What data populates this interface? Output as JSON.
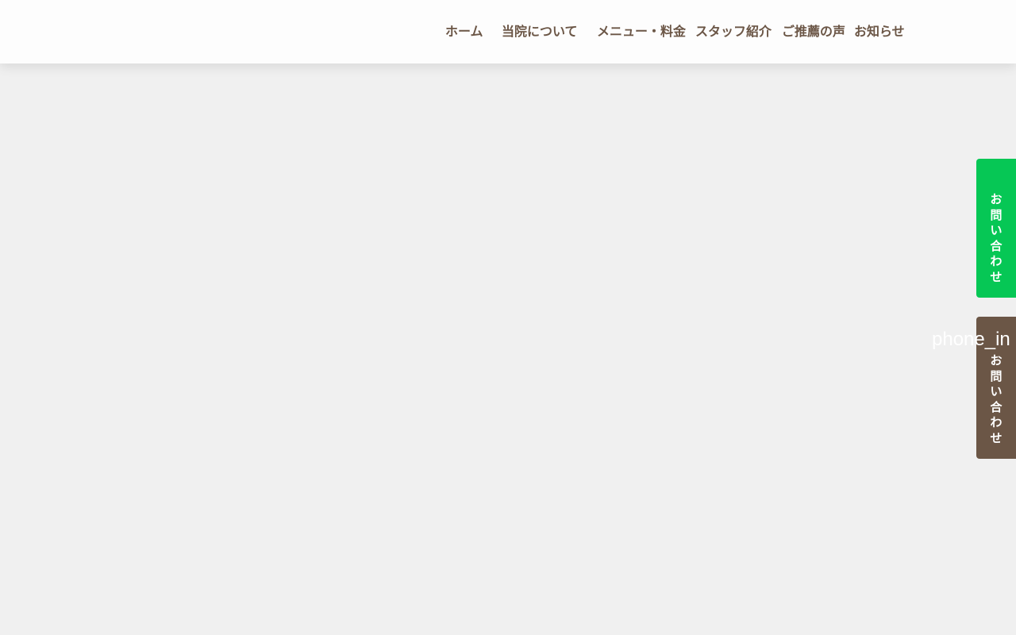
{
  "nav": {
    "items": [
      {
        "label": "ホーム"
      },
      {
        "label": "当院について"
      },
      {
        "label": "メニュー・料金"
      },
      {
        "label": "スタッフ紹介"
      },
      {
        "label": "ご推薦の声"
      },
      {
        "label": "お知らせ"
      }
    ]
  },
  "side_tabs": {
    "contact": {
      "label": "お問い合わせ",
      "color": "#06c755"
    },
    "phone": {
      "icon_text": "phone_in",
      "icon": "phone-in-talk-icon",
      "label": "お問い合わせ",
      "color": "#6b5646"
    }
  }
}
